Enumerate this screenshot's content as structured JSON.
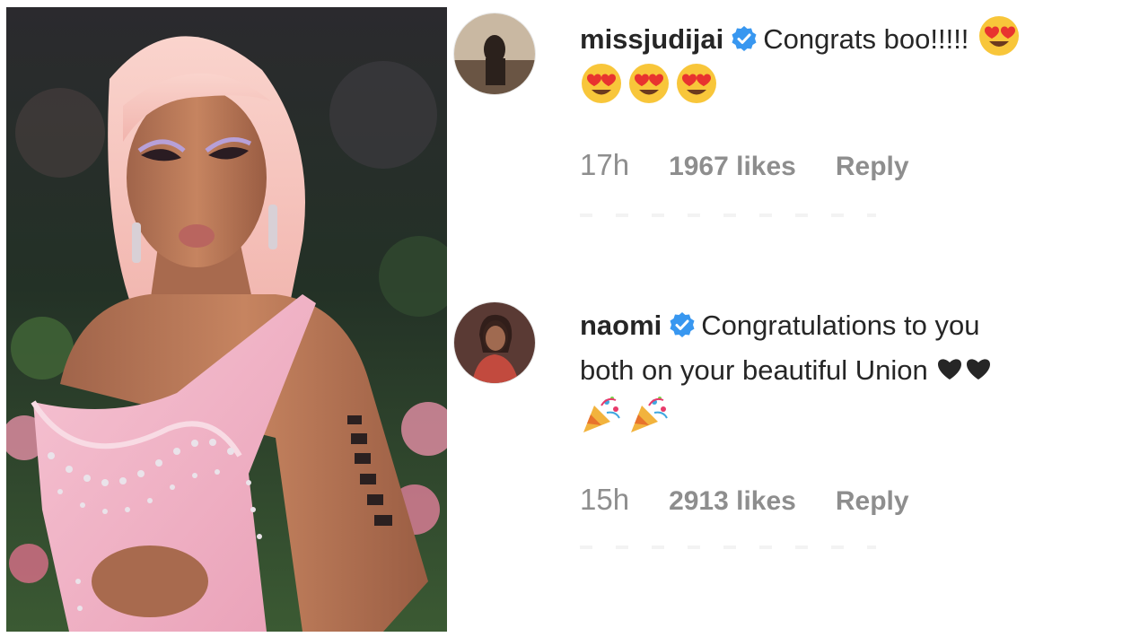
{
  "photo": {
    "alt": "Woman in pink corset gown with pink hair on red carpet"
  },
  "comments": [
    {
      "username": "missjudijai",
      "text": "Congrats boo!!!!!",
      "emojis": [
        "heart-eyes",
        "heart-eyes",
        "heart-eyes",
        "heart-eyes"
      ],
      "time": "17h",
      "likes": "1967 likes",
      "reply": "Reply"
    },
    {
      "username": "naomi",
      "text_line1": "Congratulations to you",
      "text_line2": "both on your beautiful Union",
      "emojis": [
        "black-heart",
        "black-heart",
        "party-popper",
        "party-popper"
      ],
      "time": "15h",
      "likes": "2913 likes",
      "reply": "Reply"
    }
  ],
  "colors": {
    "verified": "#3897f0",
    "username": "#262626",
    "meta": "#8e8e8e",
    "dress": "#f2b3c6",
    "hair": "#f7c6c2"
  }
}
